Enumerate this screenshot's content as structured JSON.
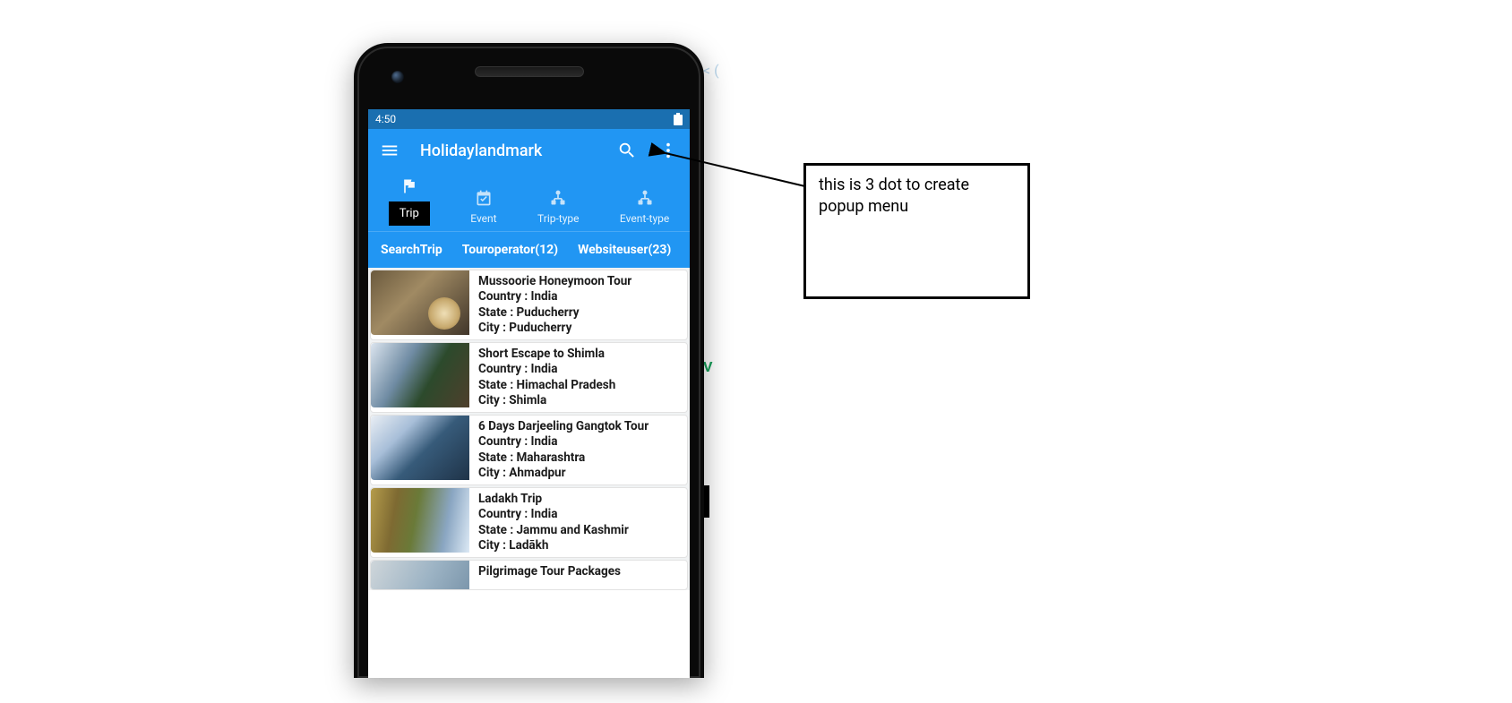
{
  "statusbar": {
    "time": "4:50"
  },
  "appbar": {
    "title": "Holidaylandmark"
  },
  "category_tabs": {
    "active_index": 0,
    "items": [
      {
        "label": "Trip"
      },
      {
        "label": "Event"
      },
      {
        "label": "Trip-type"
      },
      {
        "label": "Event-type"
      }
    ]
  },
  "sub_tabs": {
    "active_index": 0,
    "items": [
      {
        "label": "SearchTrip"
      },
      {
        "label": "Touroperator(12)"
      },
      {
        "label": "Websiteuser(23)"
      }
    ]
  },
  "field_labels": {
    "country": "Country : ",
    "state": "State : ",
    "city": "City : "
  },
  "trips": [
    {
      "title": "Mussoorie Honeymoon Tour",
      "country": "India",
      "state": "Puducherry",
      "city": "Puducherry"
    },
    {
      "title": "Short Escape to Shimla",
      "country": "India",
      "state": "Himachal Pradesh",
      "city": "Shimla"
    },
    {
      "title": "6 Days Darjeeling Gangtok Tour",
      "country": "India",
      "state": "Maharashtra",
      "city": "Ahmadpur"
    },
    {
      "title": "Ladakh Trip",
      "country": "India",
      "state": "Jammu and Kashmir",
      "city": "Ladākh"
    },
    {
      "title": "Pilgrimage Tour Packages",
      "country": "",
      "state": "",
      "city": ""
    }
  ],
  "annotation": {
    "line1": "this is 3  dot to create",
    "line2": "popup menu"
  }
}
